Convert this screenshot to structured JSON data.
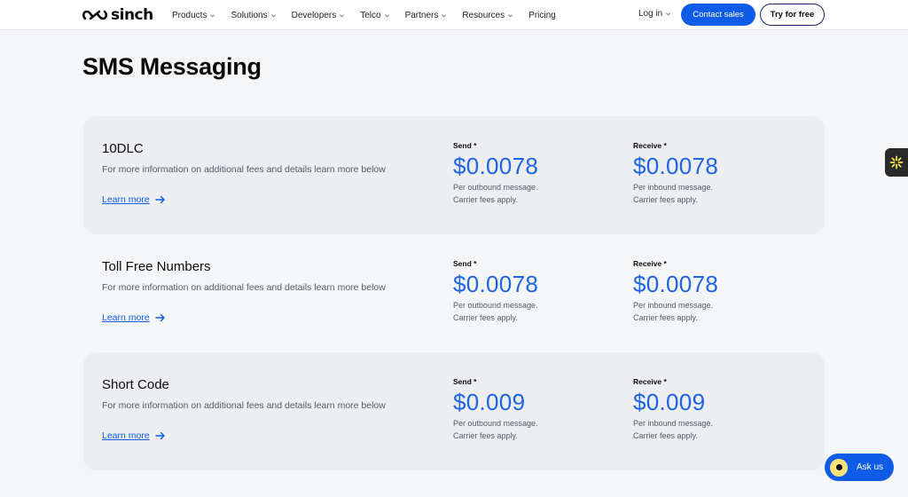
{
  "header": {
    "logo_text": "sinch",
    "nav": [
      {
        "label": "Products",
        "dropdown": true
      },
      {
        "label": "Solutions",
        "dropdown": true
      },
      {
        "label": "Developers",
        "dropdown": true
      },
      {
        "label": "Telco",
        "dropdown": true
      },
      {
        "label": "Partners",
        "dropdown": true
      },
      {
        "label": "Resources",
        "dropdown": true
      },
      {
        "label": "Pricing",
        "dropdown": false
      }
    ],
    "login_label": "Log in",
    "contact_label": "Contact sales",
    "try_label": "Try for free"
  },
  "page_title": "SMS Messaging",
  "cards": [
    {
      "title": "10DLC",
      "description": "For more information on additional fees and details learn more below",
      "learn_more": "Learn more",
      "send_label": "Send *",
      "send_price": "$0.0078",
      "send_note_1": "Per outbound message.",
      "send_note_2": "Carrier fees apply.",
      "receive_label": "Receive *",
      "receive_price": "$0.0078",
      "receive_note_1": "Per inbound message.",
      "receive_note_2": "Carrier fees apply."
    },
    {
      "title": "Toll Free Numbers",
      "description": "For more information on additional fees and details learn more below",
      "learn_more": "Learn more",
      "send_label": "Send *",
      "send_price": "$0.0078",
      "send_note_1": "Per outbound message.",
      "send_note_2": "Carrier fees apply.",
      "receive_label": "Receive *",
      "receive_price": "$0.0078",
      "receive_note_1": "Per inbound message.",
      "receive_note_2": "Carrier fees apply."
    },
    {
      "title": "Short Code",
      "description": "For more information on additional fees and details learn more below",
      "learn_more": "Learn more",
      "send_label": "Send *",
      "send_price": "$0.009",
      "send_note_1": "Per outbound message.",
      "send_note_2": "Carrier fees apply.",
      "receive_label": "Receive *",
      "receive_price": "$0.009",
      "receive_note_1": "Per inbound message.",
      "receive_note_2": "Carrier fees apply."
    }
  ],
  "widget": {
    "ask_label": "Ask us",
    "side_icon": "sparkle-icon"
  },
  "colors": {
    "accent": "#0f5ce8",
    "price": "#1f63e6",
    "card_bg": "#eceef1",
    "page_bg": "#f5f6f8"
  }
}
